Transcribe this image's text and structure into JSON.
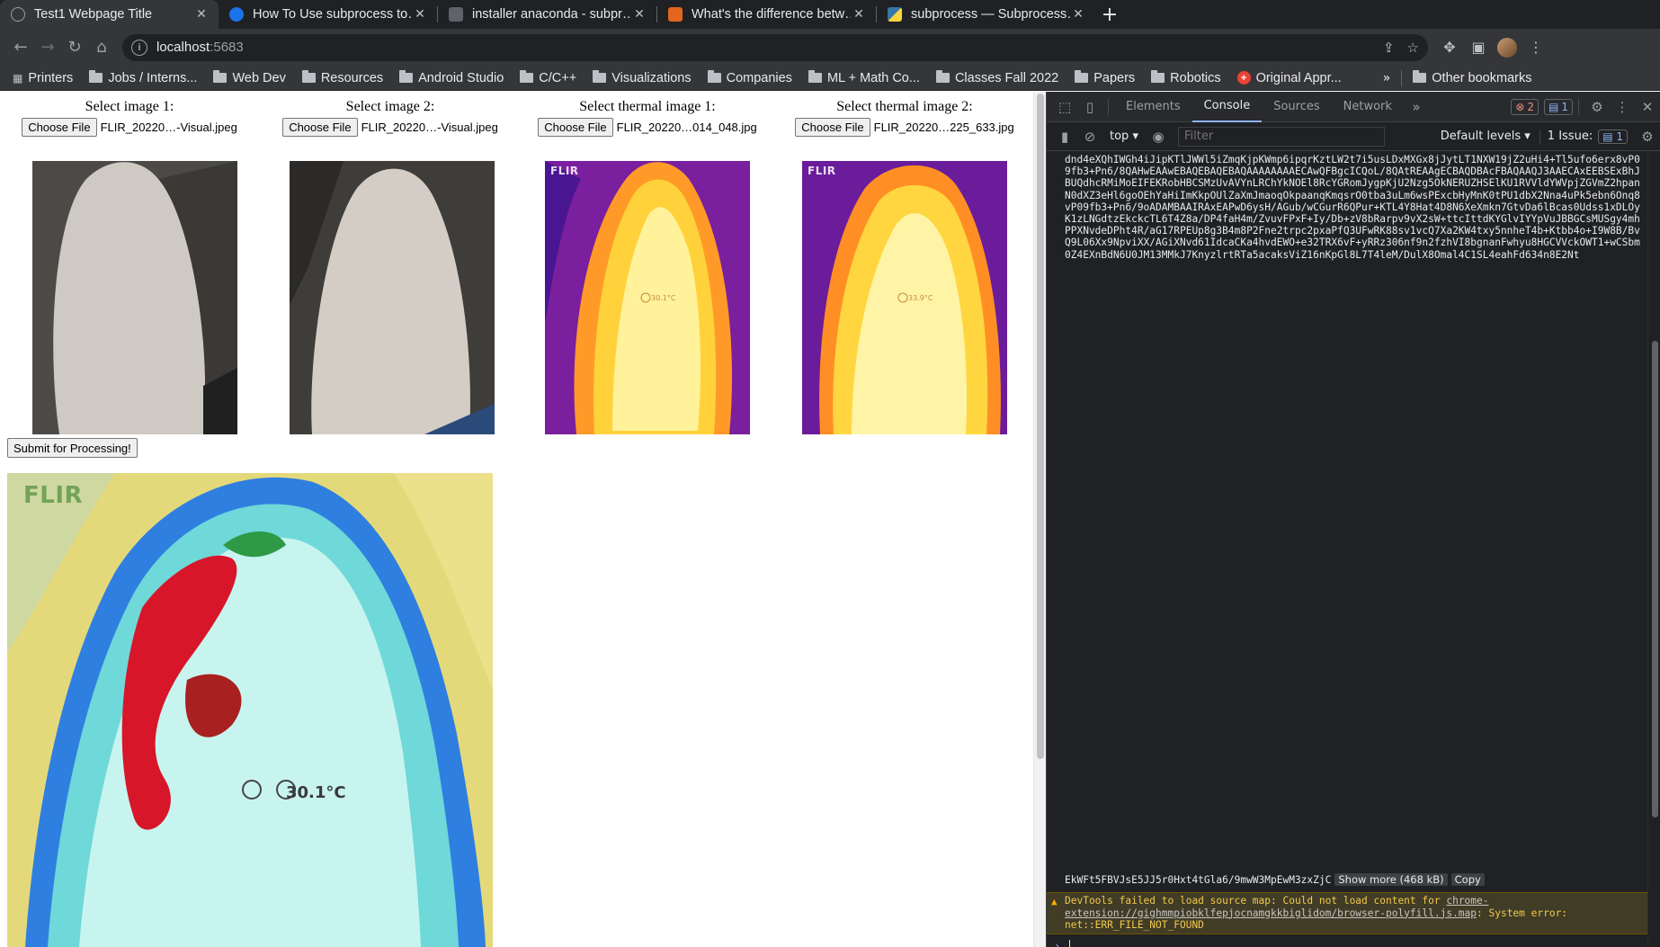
{
  "tabs": [
    {
      "title": "Test1 Webpage Title",
      "active": true,
      "favicon_color": "#5f6368"
    },
    {
      "title": "How To Use subprocess to…",
      "active": false,
      "favicon_color": "#1a73e8"
    },
    {
      "title": "installer anaconda - subpr…",
      "active": false,
      "favicon_color": "#5f6368"
    },
    {
      "title": "What's the difference betw…",
      "active": false,
      "favicon_color": "#e2661d"
    },
    {
      "title": "subprocess — Subprocess…",
      "active": false,
      "favicon_color": "#3776ab"
    }
  ],
  "toolbar": {
    "url_host": "localhost",
    "url_port": ":5683"
  },
  "bookmarks": {
    "apps_label": "Printers",
    "folders": [
      "Jobs / Interns...",
      "Web Dev",
      "Resources",
      "Android Studio",
      "C/C++",
      "Visualizations",
      "Companies",
      "ML + Math Co...",
      "Classes Fall 2022",
      "Papers",
      "Robotics"
    ],
    "special_label": "Original Appr...",
    "more": "»",
    "other_label": "Other bookmarks"
  },
  "page": {
    "uploads": [
      {
        "label": "Select image 1:",
        "button": "Choose File",
        "filename": "FLIR_20220…-Visual.jpeg"
      },
      {
        "label": "Select image 2:",
        "button": "Choose File",
        "filename": "FLIR_20220…-Visual.jpeg"
      },
      {
        "label": "Select thermal image 1:",
        "button": "Choose File",
        "filename": "FLIR_20220…014_048.jpg"
      },
      {
        "label": "Select thermal image 2:",
        "button": "Choose File",
        "filename": "FLIR_20220…225_633.jpg"
      }
    ],
    "submit_label": "Submit for Processing!",
    "flir_logo": "FLIR",
    "thermal_readout_1": "30.1°C",
    "thermal_readout_2": "33.9°C",
    "result_readout": "30.1°C",
    "colors": {
      "thermal_hot": "#fff7a8",
      "thermal_mid": "#ff8a1f",
      "thermal_cold": "#5a1a95"
    }
  },
  "devtools": {
    "tabs": [
      "Elements",
      "Console",
      "Sources",
      "Network"
    ],
    "active_tab": "Console",
    "error_count": "2",
    "info_count": "1",
    "context": "top",
    "filter_placeholder": "Filter",
    "levels": "Default levels",
    "issues_label": "1 Issue:",
    "issues_count": "1",
    "b64_text": "dnd4eXQhIWGh4iJipKTlJWWl5iZmqKjpKWmp6ipqrKztLW2t7i5usLDxMXGx8jJytLT1NXW19jZ2uHi4+Tl5ufo6erx8vP09fb3+Pn6/8QAHwEAAwEBAQEBAQEBAQAAAAAAAAECAwQFBgcICQoL/8QAtREAAgECBAQDBAcFBAQAAQJ3AAECAxEEBSExBhJBUQdhcRMiMoEIFEKRobHBCSMzUvAVYnLRChYkNOEl8RcYGRomJygpKjU2Nzg5OkNERUZHSElKU1RVVldYWVpjZGVmZ2hpanN0dXZ3eHl6goOEhYaHiImKkpOUlZaXmJmaoqOkpaanqKmqsrO0tba3uLm6wsPExcbHyMnK0tPU1dbX2Nna4uPk5ebn6Onq8vP09fb3+Pn6/9oADAMBAAIRAxEAPwD6ysH/AGub/wCGurR6QPur+KTL4Y8Hat4D8N6XeXmkn7GtvDa6lBcas0Udss1xDLOyK1zLNGdtzEkckcTL6T4Z8a/DP4faH4m/ZvuvFPxF+Iy/Db+zV8bRarpv9vX2sW+ttcIttdKYGlvIYYpVuJBBGCsMUSgy4mhPPXNvdeDPht4R/aG17RPEUp8g3B4m8P2Fne2trpc2pxaPfQ3UFwRK88sv1vcQ7Xa2KW4txy5nnheT4b+Ktbb4o+I9W8B/BvQ9L06Xx9NpviXX/AGiXNvd61IdcaCKa4hvdEWO+e32TRX6vF+yRRz306nf9n2fzhVI8bgnanFwhyu8HGCVVckOWT1+wCSbm0Z4EXnBdN6U0JM13MMkJ7KnyzlrtRTa5acaksViZ16nKpGl8L7T4leM/DulX8Omal4C1SL4eahFd634n8E2Nt",
    "b64_tail": "EkWFt5FBVJsE5JJ5r0Hxt4tGla6/9mwW3MpEwM3zxZjC",
    "show_more": "Show more (468 kB)",
    "copy": "Copy",
    "warning_prefix": "DevTools failed to load source map: Could not load content for ",
    "warning_link": "chrome-extension://gighmmpiobklfepjocnamgkkbiglidom/browser-polyfill.js.map",
    "warning_suffix": ": System error: net::ERR_FILE_NOT_FOUND"
  }
}
